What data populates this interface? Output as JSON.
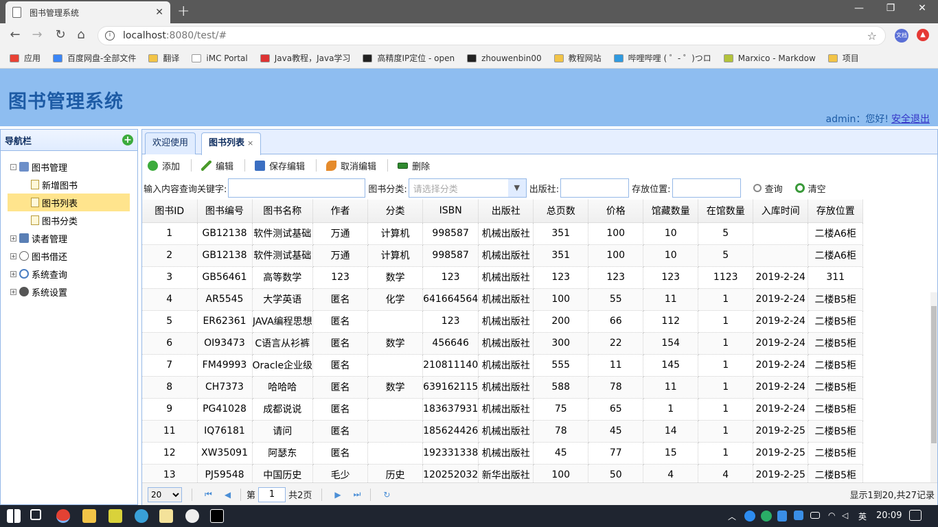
{
  "browser": {
    "tab_title": "图书管理系统",
    "url_host": "localhost",
    "url_rest": ":8080/test/#",
    "ext1_label": "文档"
  },
  "bookmarks": [
    "应用",
    "百度网盘-全部文件",
    "翻译",
    "iMC Portal",
    "Java教程，Java学习",
    "高精度IP定位 - open",
    "zhouwenbin00",
    "教程网站",
    "哔哩哔哩 ( ゜- ゜)つロ",
    "Marxico - Markdow",
    "项目"
  ],
  "header": {
    "title": "图书管理系统",
    "greeting": "admin：您好!",
    "logout": "安全退出"
  },
  "nav": {
    "title": "导航栏",
    "groups": [
      {
        "label": "图书管理",
        "toggle": "-"
      },
      {
        "label": "读者管理",
        "toggle": "+"
      },
      {
        "label": "图书借还",
        "toggle": "+"
      },
      {
        "label": "系统查询",
        "toggle": "+"
      },
      {
        "label": "系统设置",
        "toggle": "+"
      }
    ],
    "children": [
      "新增图书",
      "图书列表",
      "图书分类"
    ]
  },
  "tabs": {
    "welcome": "欢迎使用",
    "booklist": "图书列表",
    "close": "×"
  },
  "toolbar": {
    "add": "添加",
    "edit": "编辑",
    "save": "保存编辑",
    "cancel": "取消编辑",
    "delete": "删除"
  },
  "search": {
    "keyword_label": "输入内容查询关键字:",
    "category_label": "图书分类:",
    "category_placeholder": "请选择分类",
    "publisher_label": "出版社:",
    "location_label": "存放位置:",
    "query": "查询",
    "clear": "清空"
  },
  "grid": {
    "columns": [
      "图书ID",
      "图书编号",
      "图书名称",
      "作者",
      "分类",
      "ISBN",
      "出版社",
      "总页数",
      "价格",
      "馆藏数量",
      "在馆数量",
      "入库时间",
      "存放位置"
    ],
    "rows": [
      [
        "1",
        "GB12138",
        "软件测试基础",
        "万通",
        "计算机",
        "998587",
        "机械出版社",
        "351",
        "100",
        "10",
        "5",
        "",
        "二楼A6柜"
      ],
      [
        "2",
        "GB12138",
        "软件测试基础",
        "万通",
        "计算机",
        "998587",
        "机械出版社",
        "351",
        "100",
        "10",
        "5",
        "",
        "二楼A6柜"
      ],
      [
        "3",
        "GB56461",
        "高等数学",
        "123",
        "数学",
        "123",
        "机械出版社",
        "123",
        "123",
        "123",
        "1123",
        "2019-2-24",
        "311"
      ],
      [
        "4",
        "AR5545",
        "大学英语",
        "匿名",
        "化学",
        "641664564",
        "机械出版社",
        "100",
        "55",
        "11",
        "1",
        "2019-2-24",
        "二楼B5柜"
      ],
      [
        "5",
        "ER62361",
        "JAVA编程思想",
        "匿名",
        "",
        "123",
        "机械出版社",
        "200",
        "66",
        "112",
        "1",
        "2019-2-24",
        "二楼B5柜"
      ],
      [
        "6",
        "OI93473",
        "C语言从衫裤",
        "匿名",
        "数学",
        "456646",
        "机械出版社",
        "300",
        "22",
        "154",
        "1",
        "2019-2-24",
        "二楼B5柜"
      ],
      [
        "7",
        "FM49993",
        "Oracle企业级",
        "匿名",
        "",
        "210811140",
        "机械出版社",
        "555",
        "11",
        "145",
        "1",
        "2019-2-24",
        "二楼B5柜"
      ],
      [
        "8",
        "CH7373",
        "哈哈哈",
        "匿名",
        "数学",
        "639162115",
        "机械出版社",
        "588",
        "78",
        "11",
        "1",
        "2019-2-24",
        "二楼B5柜"
      ],
      [
        "9",
        "PG41028",
        "成都说说",
        "匿名",
        "",
        "183637931",
        "机械出版社",
        "75",
        "65",
        "1",
        "1",
        "2019-2-24",
        "二楼B5柜"
      ],
      [
        "11",
        "IQ76181",
        "请问",
        "匿名",
        "",
        "185624426",
        "机械出版社",
        "78",
        "45",
        "14",
        "1",
        "2019-2-25",
        "二楼B5柜"
      ],
      [
        "12",
        "XW35091",
        "阿瑟东",
        "匿名",
        "",
        "192331338",
        "机械出版社",
        "45",
        "77",
        "15",
        "1",
        "2019-2-25",
        "二楼B5柜"
      ],
      [
        "13",
        "PJ59548",
        "中国历史",
        "毛少",
        "历史",
        "120252032",
        "新华出版社",
        "100",
        "50",
        "4",
        "4",
        "2019-2-25",
        "二楼B5柜"
      ]
    ]
  },
  "pager": {
    "page_size": "20",
    "page_label": "第",
    "page_value": "1",
    "total_pages": "共2页",
    "info": "显示1到20,共27记录"
  },
  "taskbar": {
    "ime": "英",
    "time": "20:09"
  }
}
